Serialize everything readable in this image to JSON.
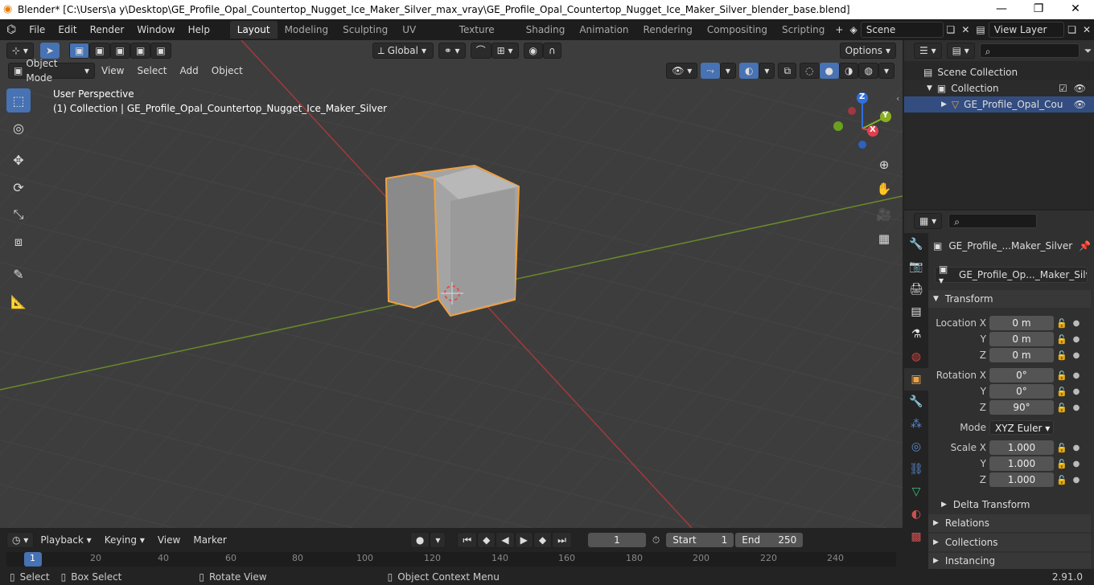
{
  "window": {
    "title": "Blender* [C:\\Users\\a y\\Desktop\\GE_Profile_Opal_Countertop_Nugget_Ice_Maker_Silver_max_vray\\GE_Profile_Opal_Countertop_Nugget_Ice_Maker_Silver_blender_base.blend]"
  },
  "menu": [
    "File",
    "Edit",
    "Render",
    "Window",
    "Help"
  ],
  "workspaces": [
    "Layout",
    "Modeling",
    "Sculpting",
    "UV Editing",
    "Texture Paint",
    "Shading",
    "Animation",
    "Rendering",
    "Compositing",
    "Scripting"
  ],
  "scene": {
    "name": "Scene",
    "view_layer": "View Layer"
  },
  "viewport": {
    "transform_orientation": "Global",
    "options_label": "Options",
    "mode": "Object Mode",
    "header_menus": [
      "View",
      "Select",
      "Add",
      "Object"
    ],
    "overlay_title": "User Perspective",
    "overlay_subtitle": "(1) Collection | GE_Profile_Opal_Countertop_Nugget_Ice_Maker_Silver",
    "gizmo_axes": {
      "x": "X",
      "y": "Y",
      "z": "Z"
    }
  },
  "outliner": {
    "scene_collection": "Scene Collection",
    "collection": "Collection",
    "object": "GE_Profile_Opal_Cou"
  },
  "properties": {
    "object_name": "GE_Profile_...Maker_Silver",
    "mesh_name": "GE_Profile_Op..._Maker_Silver",
    "transform_label": "Transform",
    "location_label": "Location X",
    "rotation_label": "Rotation X",
    "scale_label": "Scale X",
    "axis_y": "Y",
    "axis_z": "Z",
    "location": [
      "0 m",
      "0 m",
      "0 m"
    ],
    "rotation": [
      "0°",
      "0°",
      "90°"
    ],
    "mode_label": "Mode",
    "mode_value": "XYZ Euler",
    "scale": [
      "1.000",
      "1.000",
      "1.000"
    ],
    "sections": [
      "Delta Transform",
      "Relations",
      "Collections",
      "Instancing"
    ]
  },
  "timeline": {
    "menus": [
      "Playback",
      "Keying",
      "View",
      "Marker"
    ],
    "current_frame": "1",
    "start_label": "Start",
    "start": "1",
    "end_label": "End",
    "end": "250",
    "ticks": [
      "1",
      "20",
      "40",
      "60",
      "80",
      "100",
      "120",
      "140",
      "160",
      "180",
      "200",
      "220",
      "240"
    ]
  },
  "statusbar": {
    "select": "Select",
    "box_select": "Box Select",
    "rotate_view": "Rotate View",
    "context_menu": "Object Context Menu",
    "version": "2.91.0"
  },
  "colors": {
    "accent": "#4772b3",
    "selection_outline": "#f0a040",
    "x_axis": "#e04050",
    "y_axis": "#8ab020",
    "z_axis": "#3070e0"
  }
}
